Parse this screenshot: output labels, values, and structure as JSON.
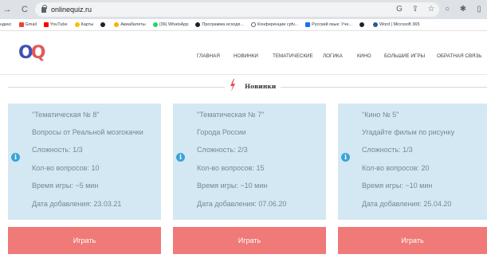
{
  "browser": {
    "url": "onlinequiz.ru",
    "nav": {
      "back": "→",
      "reload": "C"
    },
    "toolbar_icons": [
      "G",
      "⇪",
      "☆",
      "○",
      "✱",
      "▯"
    ],
    "bookmarks": [
      {
        "label": "ндекс",
        "color": "#ff0000"
      },
      {
        "label": "Gmail",
        "color": "#ea4335"
      },
      {
        "label": "YouTube",
        "color": "#ff0000"
      },
      {
        "label": "Карты",
        "color": "#fbbc04"
      },
      {
        "label": "",
        "color": "#202124"
      },
      {
        "label": "Авиабилеты",
        "color": "#f4b400"
      },
      {
        "label": "(36) WhatsApp",
        "color": "#25d366"
      },
      {
        "label": "Программа исходя...",
        "color": "#202124"
      },
      {
        "label": "Конференции срfv...",
        "color": "#5f6368"
      },
      {
        "label": "Русский язык: Уче...",
        "color": "#1a73e8"
      },
      {
        "label": "",
        "color": "#202124"
      },
      {
        "label": "Word | Microsoft 365",
        "color": "#2b579a"
      }
    ]
  },
  "site": {
    "logo": {
      "first": "O",
      "second": "Q"
    },
    "menu": [
      "ГЛАВНАЯ",
      "НОВИНКИ",
      "ТЕМАТИЧЕСКИЕ",
      "ЛОГИКА",
      "КИНО",
      "БОЛЬШИЕ ИГРЫ",
      "ОБРАТНАЯ СВЯЗЬ"
    ],
    "section_title": "Новинки",
    "quizzes": [
      {
        "title": "\"Тематическая № 8\"",
        "subtitle": "Вопросы от Реальной мозгокачки",
        "difficulty": "Сложность: 1/3",
        "questions": "Кол-во вопросов: 10",
        "duration": "Время игры: ~5 мин",
        "added": "Дата добавления: 23.03.21",
        "button": "Играть"
      },
      {
        "title": "\"Тематическая № 7\"",
        "subtitle": "Города России",
        "difficulty": "Сложность: 2/3",
        "questions": "Кол-во вопросов: 15",
        "duration": "Время игры: ~10 мин",
        "added": "Дата добавления: 07.06.20",
        "button": "Играть"
      },
      {
        "title": "\"Кино № 5\"",
        "subtitle": "Угадайте фильм по рисунку",
        "difficulty": "Сложность: 1/3",
        "questions": "Кол-во вопросов: 20",
        "duration": "Время игры: ~10 мин",
        "added": "Дата добавления: 25.04.20",
        "button": "Играть"
      }
    ],
    "info_icon_glyph": "i"
  },
  "colors": {
    "card_bg": "#d4e8f3",
    "button_bg": "#ef7a78",
    "info_icon": "#3aa3d9",
    "accent_red": "#e8504c",
    "logo_blue": "#3f51b5"
  }
}
